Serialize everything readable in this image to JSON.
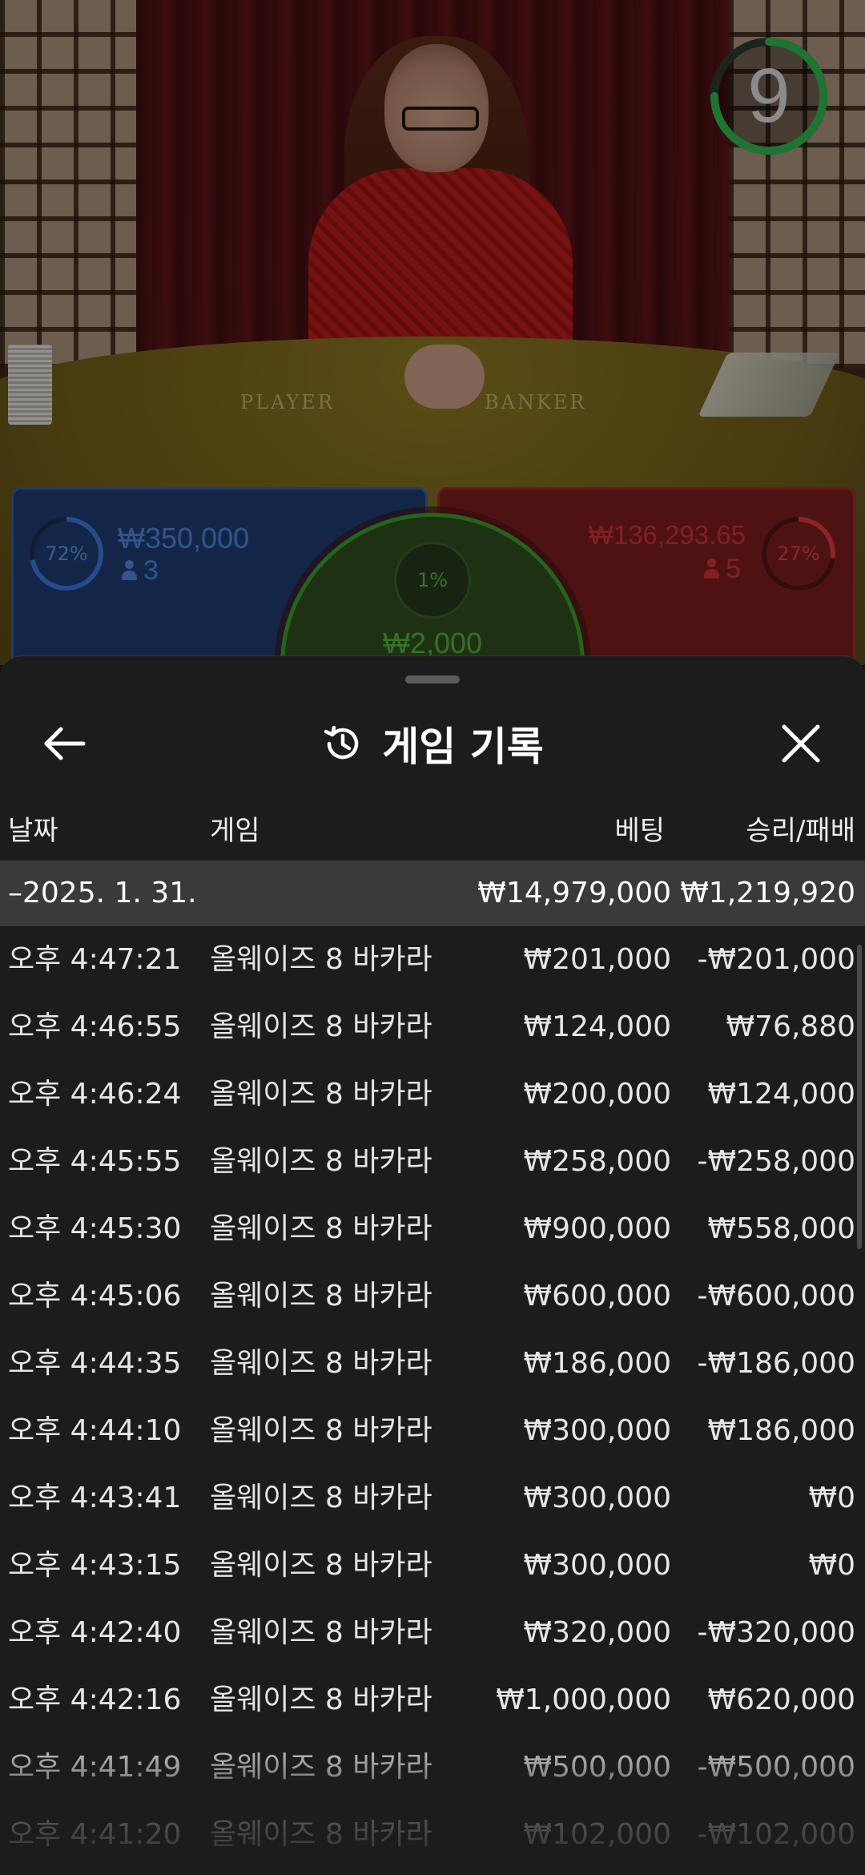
{
  "live_game": {
    "timer_value": "9",
    "timer_progress": 0.75,
    "felt_player_label": "PLAYER",
    "felt_banker_label": "BANKER",
    "player": {
      "percent": "72%",
      "percent_value": 0.72,
      "amount": "₩350,000",
      "players": "3"
    },
    "banker": {
      "percent": "27%",
      "percent_value": 0.27,
      "amount": "₩136,293.65",
      "players": "5"
    },
    "tie": {
      "percent": "1%",
      "amount": "₩2,000"
    },
    "colors": {
      "player": "#2d5fb0",
      "banker": "#c93232",
      "tie": "#3a9a2a",
      "timer": "#2fb34a"
    }
  },
  "sheet": {
    "title": "게임 기록",
    "columns": {
      "date": "날짜",
      "game": "게임",
      "bet": "베팅",
      "result": "승리/패배"
    },
    "summary": {
      "date": "–2025. 1. 31.",
      "bet": "₩14,979,000",
      "result": "₩1,219,920"
    },
    "rows": [
      {
        "time": "오후 4:47:21",
        "game": "올웨이즈 8 바카라",
        "bet": "₩201,000",
        "result": "-₩201,000"
      },
      {
        "time": "오후 4:46:55",
        "game": "올웨이즈 8 바카라",
        "bet": "₩124,000",
        "result": "₩76,880"
      },
      {
        "time": "오후 4:46:24",
        "game": "올웨이즈 8 바카라",
        "bet": "₩200,000",
        "result": "₩124,000"
      },
      {
        "time": "오후 4:45:55",
        "game": "올웨이즈 8 바카라",
        "bet": "₩258,000",
        "result": "-₩258,000"
      },
      {
        "time": "오후 4:45:30",
        "game": "올웨이즈 8 바카라",
        "bet": "₩900,000",
        "result": "₩558,000"
      },
      {
        "time": "오후 4:45:06",
        "game": "올웨이즈 8 바카라",
        "bet": "₩600,000",
        "result": "-₩600,000"
      },
      {
        "time": "오후 4:44:35",
        "game": "올웨이즈 8 바카라",
        "bet": "₩186,000",
        "result": "-₩186,000"
      },
      {
        "time": "오후 4:44:10",
        "game": "올웨이즈 8 바카라",
        "bet": "₩300,000",
        "result": "₩186,000"
      },
      {
        "time": "오후 4:43:41",
        "game": "올웨이즈 8 바카라",
        "bet": "₩300,000",
        "result": "₩0"
      },
      {
        "time": "오후 4:43:15",
        "game": "올웨이즈 8 바카라",
        "bet": "₩300,000",
        "result": "₩0"
      },
      {
        "time": "오후 4:42:40",
        "game": "올웨이즈 8 바카라",
        "bet": "₩320,000",
        "result": "-₩320,000"
      },
      {
        "time": "오후 4:42:16",
        "game": "올웨이즈 8 바카라",
        "bet": "₩1,000,000",
        "result": "₩620,000"
      },
      {
        "time": "오후 4:41:49",
        "game": "올웨이즈 8 바카라",
        "bet": "₩500,000",
        "result": "-₩500,000"
      },
      {
        "time": "오후 4:41:20",
        "game": "올웨이즈 8 바카라",
        "bet": "₩102,000",
        "result": "-₩102,000"
      }
    ]
  },
  "icons": {
    "back": "arrow-left-icon",
    "history": "history-icon",
    "close": "close-icon",
    "person": "person-icon"
  }
}
